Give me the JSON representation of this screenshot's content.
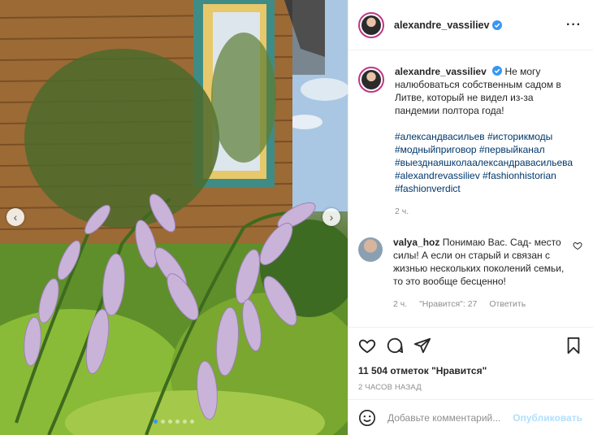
{
  "post": {
    "username": "alexandre_vassiliev",
    "caption": "Не могу налюбоваться собственным садом в Литве, который не видел из-за пандемии полтора года!",
    "hashtags": "#александвасильев #историкмоды #модныйприговор #первыйканал #выезднаяшколаалександравасильева #alexandrevassiliev #fashionhistorian #fashionverdict",
    "caption_time": "2 ч."
  },
  "comment": {
    "username": "valya_hoz",
    "text": "Понимаю Вас. Сад- место силы! А если он старый и связан с жизнью нескольких поколений семьи, то это вообще бесценно!",
    "time": "2 ч.",
    "likes": "\"Нравится\": 27",
    "reply": "Ответить"
  },
  "stats": {
    "likes_count": "11 504 отметок \"Нравится\"",
    "posted_ago": "2 ЧАСОВ НАЗАД"
  },
  "composer": {
    "placeholder": "Добавьте комментарий...",
    "post_label": "Опубликовать"
  },
  "carousel": {
    "slide_count": 6,
    "active_index": 0
  },
  "colors": {
    "verified": "#3897f0",
    "hashtag": "#00376b",
    "post_button": "#b2dffc",
    "muted": "#8e8e8e"
  },
  "icons": [
    "more-options-icon",
    "verified-badge-icon",
    "heart-icon",
    "comment-icon",
    "share-icon",
    "bookmark-icon",
    "emoji-icon",
    "chevron-left-icon",
    "chevron-right-icon"
  ]
}
